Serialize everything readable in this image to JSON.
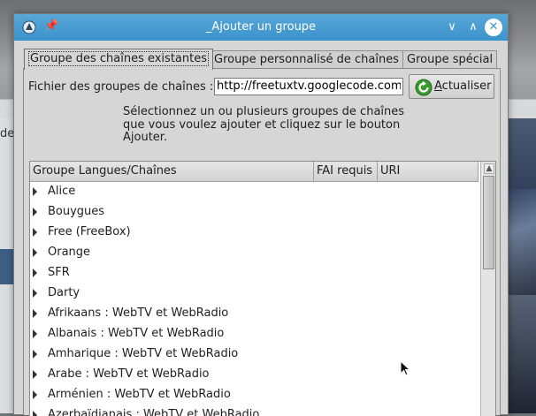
{
  "dialog": {
    "title": "_Ajouter un groupe",
    "pin_glyph": "📌",
    "min_glyph": "∨",
    "max_glyph": "∧",
    "close_glyph": "✕"
  },
  "tabs": [
    {
      "label": "Groupe des chaînes existantes",
      "active": true
    },
    {
      "label": "Groupe personnalisé de chaînes",
      "active": false
    },
    {
      "label": "Groupe spécial",
      "active": false
    }
  ],
  "source": {
    "label": "Fichier des groupes de chaînes :",
    "url_value": "http://freetuxtv.googlecode.com/",
    "refresh_label_accel": "A",
    "refresh_label_rest": "ctualiser"
  },
  "help_text": "Sélectionnez un ou plusieurs groupes de chaînes que vous voulez ajouter et cliquez sur le bouton Ajouter.",
  "tree": {
    "columns": [
      "Groupe Langues/Chaînes",
      "FAI requis",
      "URI"
    ],
    "rows": [
      "Alice",
      "Bouygues",
      "Free (FreeBox)",
      "Orange",
      "SFR",
      "Darty",
      "Afrikaans : WebTV et WebRadio",
      "Albanais : WebTV et WebRadio",
      "Amharique : WebTV et WebRadio",
      "Arabe : WebTV et WebRadio",
      "Arménien : WebTV et WebRadio",
      "Azerbaïdjanais : WebTV et WebRadio"
    ]
  },
  "background": {
    "left_fragment": "de",
    "right_fragment": "D R"
  },
  "colors": {
    "titlebar": "#3b93cc",
    "dialog_bg": "#d6d6d6"
  }
}
